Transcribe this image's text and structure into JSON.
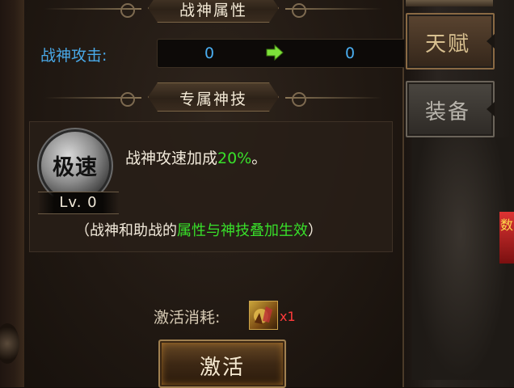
{
  "header_attributes": {
    "title": "战神属性"
  },
  "attribute": {
    "label": "战神攻击:",
    "current_value": "0",
    "next_value": "0",
    "arrow_color": "#7ee23a"
  },
  "header_skill": {
    "title": "专属神技"
  },
  "skill": {
    "badge_text": "极速",
    "level_text": "Lv. 0",
    "desc_prefix": "战神攻速加成",
    "desc_value": "20%",
    "desc_suffix": "。",
    "note_prefix": "（战神和助战的",
    "note_highlight": "属性与神技叠加生效",
    "note_suffix": "）"
  },
  "cost": {
    "label": "激活消耗:",
    "quantity": "x1",
    "item_icon": "item-scroll-icon"
  },
  "activate_button": {
    "label": "激活"
  },
  "side_tabs": [
    {
      "label": "天赋"
    },
    {
      "label": "装备"
    }
  ],
  "edge_text": {
    "char": "数"
  },
  "colors": {
    "attr_blue": "#49a9e8",
    "highlight_green": "#38e02a",
    "qty_red": "#ff3b3b"
  }
}
